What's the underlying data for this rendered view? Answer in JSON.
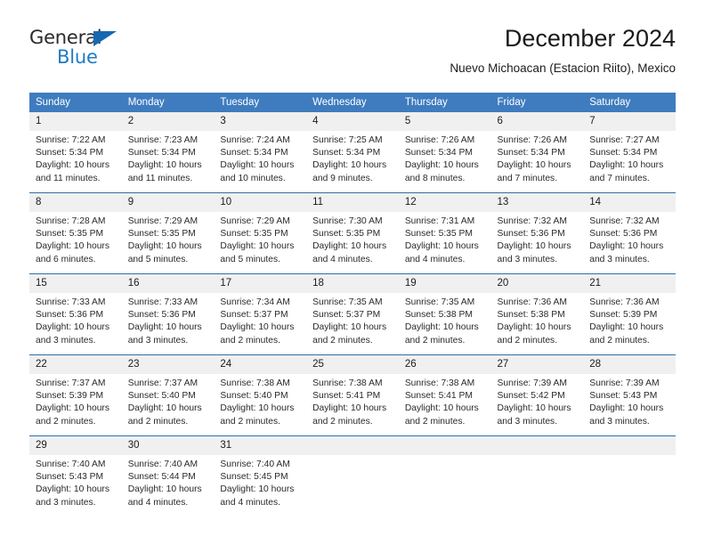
{
  "logo": {
    "word_top": "General",
    "word_bottom": "Blue",
    "triangle_icon": "triangle-icon",
    "accent_color": "#1e7cc4"
  },
  "header": {
    "title": "December 2024",
    "subtitle": "Nuevo Michoacan (Estacion Riito), Mexico"
  },
  "theme": {
    "header_blue": "#3f7cbf",
    "row_divider_blue": "#2f6fa8",
    "day_band_gray": "#f0f0f0"
  },
  "calendar": {
    "weekday_headers": [
      "Sunday",
      "Monday",
      "Tuesday",
      "Wednesday",
      "Thursday",
      "Friday",
      "Saturday"
    ],
    "weeks": [
      [
        {
          "day": "1",
          "sunrise": "Sunrise: 7:22 AM",
          "sunset": "Sunset: 5:34 PM",
          "daylight_line1": "Daylight: 10 hours",
          "daylight_line2": "and 11 minutes."
        },
        {
          "day": "2",
          "sunrise": "Sunrise: 7:23 AM",
          "sunset": "Sunset: 5:34 PM",
          "daylight_line1": "Daylight: 10 hours",
          "daylight_line2": "and 11 minutes."
        },
        {
          "day": "3",
          "sunrise": "Sunrise: 7:24 AM",
          "sunset": "Sunset: 5:34 PM",
          "daylight_line1": "Daylight: 10 hours",
          "daylight_line2": "and 10 minutes."
        },
        {
          "day": "4",
          "sunrise": "Sunrise: 7:25 AM",
          "sunset": "Sunset: 5:34 PM",
          "daylight_line1": "Daylight: 10 hours",
          "daylight_line2": "and 9 minutes."
        },
        {
          "day": "5",
          "sunrise": "Sunrise: 7:26 AM",
          "sunset": "Sunset: 5:34 PM",
          "daylight_line1": "Daylight: 10 hours",
          "daylight_line2": "and 8 minutes."
        },
        {
          "day": "6",
          "sunrise": "Sunrise: 7:26 AM",
          "sunset": "Sunset: 5:34 PM",
          "daylight_line1": "Daylight: 10 hours",
          "daylight_line2": "and 7 minutes."
        },
        {
          "day": "7",
          "sunrise": "Sunrise: 7:27 AM",
          "sunset": "Sunset: 5:34 PM",
          "daylight_line1": "Daylight: 10 hours",
          "daylight_line2": "and 7 minutes."
        }
      ],
      [
        {
          "day": "8",
          "sunrise": "Sunrise: 7:28 AM",
          "sunset": "Sunset: 5:35 PM",
          "daylight_line1": "Daylight: 10 hours",
          "daylight_line2": "and 6 minutes."
        },
        {
          "day": "9",
          "sunrise": "Sunrise: 7:29 AM",
          "sunset": "Sunset: 5:35 PM",
          "daylight_line1": "Daylight: 10 hours",
          "daylight_line2": "and 5 minutes."
        },
        {
          "day": "10",
          "sunrise": "Sunrise: 7:29 AM",
          "sunset": "Sunset: 5:35 PM",
          "daylight_line1": "Daylight: 10 hours",
          "daylight_line2": "and 5 minutes."
        },
        {
          "day": "11",
          "sunrise": "Sunrise: 7:30 AM",
          "sunset": "Sunset: 5:35 PM",
          "daylight_line1": "Daylight: 10 hours",
          "daylight_line2": "and 4 minutes."
        },
        {
          "day": "12",
          "sunrise": "Sunrise: 7:31 AM",
          "sunset": "Sunset: 5:35 PM",
          "daylight_line1": "Daylight: 10 hours",
          "daylight_line2": "and 4 minutes."
        },
        {
          "day": "13",
          "sunrise": "Sunrise: 7:32 AM",
          "sunset": "Sunset: 5:36 PM",
          "daylight_line1": "Daylight: 10 hours",
          "daylight_line2": "and 3 minutes."
        },
        {
          "day": "14",
          "sunrise": "Sunrise: 7:32 AM",
          "sunset": "Sunset: 5:36 PM",
          "daylight_line1": "Daylight: 10 hours",
          "daylight_line2": "and 3 minutes."
        }
      ],
      [
        {
          "day": "15",
          "sunrise": "Sunrise: 7:33 AM",
          "sunset": "Sunset: 5:36 PM",
          "daylight_line1": "Daylight: 10 hours",
          "daylight_line2": "and 3 minutes."
        },
        {
          "day": "16",
          "sunrise": "Sunrise: 7:33 AM",
          "sunset": "Sunset: 5:36 PM",
          "daylight_line1": "Daylight: 10 hours",
          "daylight_line2": "and 3 minutes."
        },
        {
          "day": "17",
          "sunrise": "Sunrise: 7:34 AM",
          "sunset": "Sunset: 5:37 PM",
          "daylight_line1": "Daylight: 10 hours",
          "daylight_line2": "and 2 minutes."
        },
        {
          "day": "18",
          "sunrise": "Sunrise: 7:35 AM",
          "sunset": "Sunset: 5:37 PM",
          "daylight_line1": "Daylight: 10 hours",
          "daylight_line2": "and 2 minutes."
        },
        {
          "day": "19",
          "sunrise": "Sunrise: 7:35 AM",
          "sunset": "Sunset: 5:38 PM",
          "daylight_line1": "Daylight: 10 hours",
          "daylight_line2": "and 2 minutes."
        },
        {
          "day": "20",
          "sunrise": "Sunrise: 7:36 AM",
          "sunset": "Sunset: 5:38 PM",
          "daylight_line1": "Daylight: 10 hours",
          "daylight_line2": "and 2 minutes."
        },
        {
          "day": "21",
          "sunrise": "Sunrise: 7:36 AM",
          "sunset": "Sunset: 5:39 PM",
          "daylight_line1": "Daylight: 10 hours",
          "daylight_line2": "and 2 minutes."
        }
      ],
      [
        {
          "day": "22",
          "sunrise": "Sunrise: 7:37 AM",
          "sunset": "Sunset: 5:39 PM",
          "daylight_line1": "Daylight: 10 hours",
          "daylight_line2": "and 2 minutes."
        },
        {
          "day": "23",
          "sunrise": "Sunrise: 7:37 AM",
          "sunset": "Sunset: 5:40 PM",
          "daylight_line1": "Daylight: 10 hours",
          "daylight_line2": "and 2 minutes."
        },
        {
          "day": "24",
          "sunrise": "Sunrise: 7:38 AM",
          "sunset": "Sunset: 5:40 PM",
          "daylight_line1": "Daylight: 10 hours",
          "daylight_line2": "and 2 minutes."
        },
        {
          "day": "25",
          "sunrise": "Sunrise: 7:38 AM",
          "sunset": "Sunset: 5:41 PM",
          "daylight_line1": "Daylight: 10 hours",
          "daylight_line2": "and 2 minutes."
        },
        {
          "day": "26",
          "sunrise": "Sunrise: 7:38 AM",
          "sunset": "Sunset: 5:41 PM",
          "daylight_line1": "Daylight: 10 hours",
          "daylight_line2": "and 2 minutes."
        },
        {
          "day": "27",
          "sunrise": "Sunrise: 7:39 AM",
          "sunset": "Sunset: 5:42 PM",
          "daylight_line1": "Daylight: 10 hours",
          "daylight_line2": "and 3 minutes."
        },
        {
          "day": "28",
          "sunrise": "Sunrise: 7:39 AM",
          "sunset": "Sunset: 5:43 PM",
          "daylight_line1": "Daylight: 10 hours",
          "daylight_line2": "and 3 minutes."
        }
      ],
      [
        {
          "day": "29",
          "sunrise": "Sunrise: 7:40 AM",
          "sunset": "Sunset: 5:43 PM",
          "daylight_line1": "Daylight: 10 hours",
          "daylight_line2": "and 3 minutes."
        },
        {
          "day": "30",
          "sunrise": "Sunrise: 7:40 AM",
          "sunset": "Sunset: 5:44 PM",
          "daylight_line1": "Daylight: 10 hours",
          "daylight_line2": "and 4 minutes."
        },
        {
          "day": "31",
          "sunrise": "Sunrise: 7:40 AM",
          "sunset": "Sunset: 5:45 PM",
          "daylight_line1": "Daylight: 10 hours",
          "daylight_line2": "and 4 minutes."
        },
        {
          "day": "",
          "sunrise": "",
          "sunset": "",
          "daylight_line1": "",
          "daylight_line2": ""
        },
        {
          "day": "",
          "sunrise": "",
          "sunset": "",
          "daylight_line1": "",
          "daylight_line2": ""
        },
        {
          "day": "",
          "sunrise": "",
          "sunset": "",
          "daylight_line1": "",
          "daylight_line2": ""
        },
        {
          "day": "",
          "sunrise": "",
          "sunset": "",
          "daylight_line1": "",
          "daylight_line2": ""
        }
      ]
    ]
  }
}
